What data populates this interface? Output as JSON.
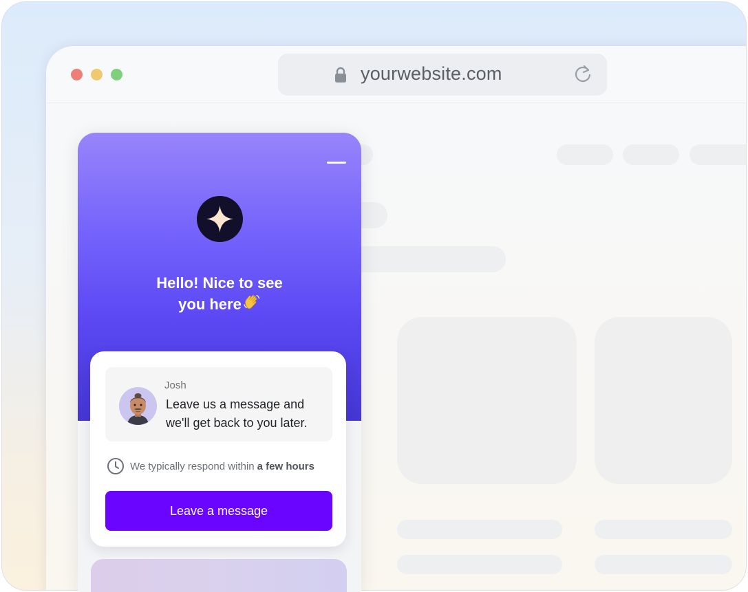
{
  "browser": {
    "url": "yourwebsite.com",
    "window_controls": [
      "close",
      "minimize",
      "maximize"
    ]
  },
  "widget": {
    "greeting_line1": "Hello! Nice to see",
    "greeting_line2": "you here",
    "greeting_emoji": "waving-hand",
    "message": {
      "sender": "Josh",
      "text_line1": "Leave us a message and",
      "text_line2": "we'll get back to you later."
    },
    "response_prefix": "We typically respond within",
    "response_time": "a few hours",
    "cta_label": "Leave a message"
  },
  "colors": {
    "accent": "#6a06ff",
    "hero_top": "#9884fb",
    "hero_bottom": "#4436d2",
    "logo_bg": "#120f2a",
    "logo_star": "#fde6cf"
  }
}
